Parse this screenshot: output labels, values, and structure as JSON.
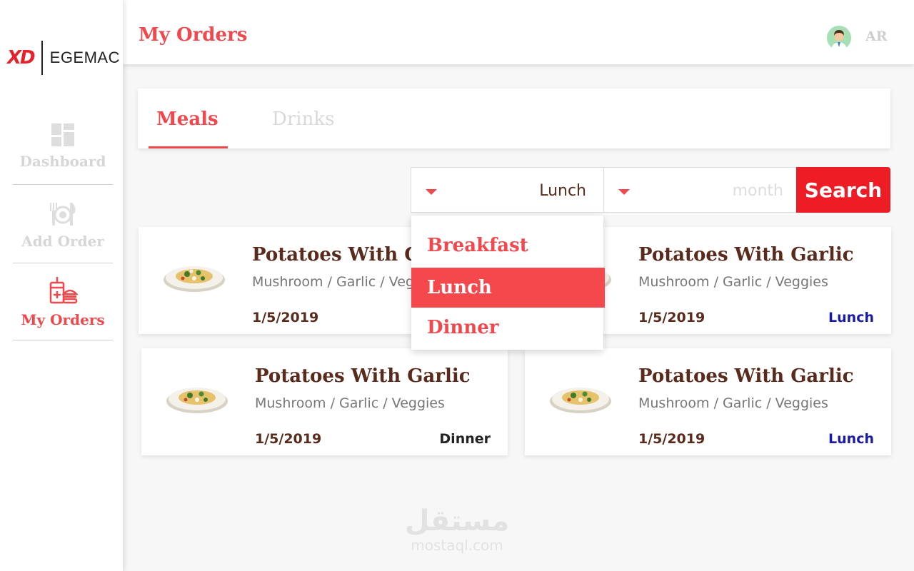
{
  "brand": {
    "mark": "XD",
    "name": "EGEMAC"
  },
  "sidebar": {
    "items": [
      {
        "label": "Dashboard",
        "icon": "dashboard-icon",
        "active": false
      },
      {
        "label": "Add Order",
        "icon": "cutlery-icon",
        "active": false
      },
      {
        "label": "My Orders",
        "icon": "food-tray-icon",
        "active": true
      }
    ]
  },
  "header": {
    "title": "My Orders",
    "language": "AR"
  },
  "tabs": [
    {
      "label": "Meals",
      "active": true
    },
    {
      "label": "Drinks",
      "active": false
    }
  ],
  "filters": {
    "meal_value": "Lunch",
    "month_placeholder": "month",
    "search_label": "Search"
  },
  "dropdown": {
    "options": [
      "Breakfast",
      "Lunch",
      "Dinner"
    ],
    "selected": "Lunch"
  },
  "orders": [
    {
      "title": "Potatoes With Garlic",
      "ingredients": "Mushroom / Garlic / Veggies",
      "date": "1/5/2019",
      "meal": ""
    },
    {
      "title": "Potatoes With Garlic",
      "ingredients": "Mushroom / Garlic / Veggies",
      "date": "1/5/2019",
      "meal": "Lunch"
    },
    {
      "title": "Potatoes With Garlic",
      "ingredients": "Mushroom / Garlic / Veggies",
      "date": "1/5/2019",
      "meal": "Dinner"
    },
    {
      "title": "Potatoes With Garlic",
      "ingredients": "Mushroom / Garlic / Veggies",
      "date": "1/5/2019",
      "meal": "Lunch"
    }
  ],
  "watermark": {
    "arabic": "مستقل",
    "latin": "mostaql.com"
  },
  "colors": {
    "accent": "#f0484d",
    "search": "#ee1c25",
    "title_brown": "#5a2b1c",
    "lunch_blue": "#1a1aa6",
    "dinner_dark": "#222222"
  }
}
